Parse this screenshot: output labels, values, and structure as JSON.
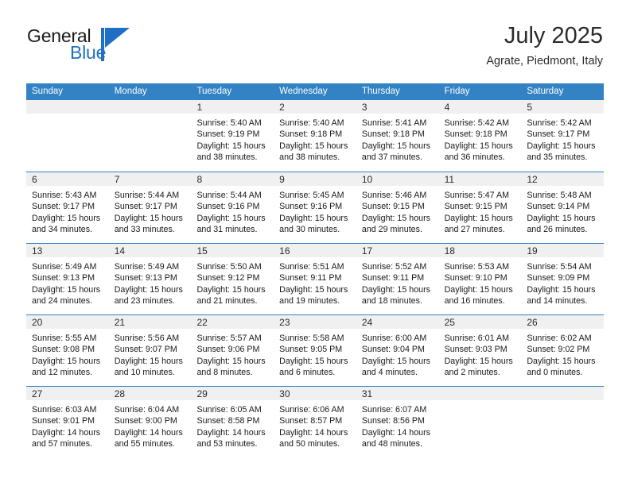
{
  "brand": {
    "name_part1": "General",
    "name_part2": "Blue",
    "logo_icon": "triangle-flag-logo",
    "accent_color": "#1F6FC4"
  },
  "header": {
    "month_title": "July 2025",
    "location": "Agrate, Piedmont, Italy"
  },
  "theme": {
    "header_blue": "#3282C4",
    "daynum_strip": "#F0F0F0",
    "text": "#1a1a1a"
  },
  "weekdays": [
    "Sunday",
    "Monday",
    "Tuesday",
    "Wednesday",
    "Thursday",
    "Friday",
    "Saturday"
  ],
  "weeks": [
    [
      {
        "day": "",
        "lines": []
      },
      {
        "day": "",
        "lines": []
      },
      {
        "day": "1",
        "lines": [
          "Sunrise: 5:40 AM",
          "Sunset: 9:19 PM",
          "Daylight: 15 hours",
          "and 38 minutes."
        ]
      },
      {
        "day": "2",
        "lines": [
          "Sunrise: 5:40 AM",
          "Sunset: 9:18 PM",
          "Daylight: 15 hours",
          "and 38 minutes."
        ]
      },
      {
        "day": "3",
        "lines": [
          "Sunrise: 5:41 AM",
          "Sunset: 9:18 PM",
          "Daylight: 15 hours",
          "and 37 minutes."
        ]
      },
      {
        "day": "4",
        "lines": [
          "Sunrise: 5:42 AM",
          "Sunset: 9:18 PM",
          "Daylight: 15 hours",
          "and 36 minutes."
        ]
      },
      {
        "day": "5",
        "lines": [
          "Sunrise: 5:42 AM",
          "Sunset: 9:17 PM",
          "Daylight: 15 hours",
          "and 35 minutes."
        ]
      }
    ],
    [
      {
        "day": "6",
        "lines": [
          "Sunrise: 5:43 AM",
          "Sunset: 9:17 PM",
          "Daylight: 15 hours",
          "and 34 minutes."
        ]
      },
      {
        "day": "7",
        "lines": [
          "Sunrise: 5:44 AM",
          "Sunset: 9:17 PM",
          "Daylight: 15 hours",
          "and 33 minutes."
        ]
      },
      {
        "day": "8",
        "lines": [
          "Sunrise: 5:44 AM",
          "Sunset: 9:16 PM",
          "Daylight: 15 hours",
          "and 31 minutes."
        ]
      },
      {
        "day": "9",
        "lines": [
          "Sunrise: 5:45 AM",
          "Sunset: 9:16 PM",
          "Daylight: 15 hours",
          "and 30 minutes."
        ]
      },
      {
        "day": "10",
        "lines": [
          "Sunrise: 5:46 AM",
          "Sunset: 9:15 PM",
          "Daylight: 15 hours",
          "and 29 minutes."
        ]
      },
      {
        "day": "11",
        "lines": [
          "Sunrise: 5:47 AM",
          "Sunset: 9:15 PM",
          "Daylight: 15 hours",
          "and 27 minutes."
        ]
      },
      {
        "day": "12",
        "lines": [
          "Sunrise: 5:48 AM",
          "Sunset: 9:14 PM",
          "Daylight: 15 hours",
          "and 26 minutes."
        ]
      }
    ],
    [
      {
        "day": "13",
        "lines": [
          "Sunrise: 5:49 AM",
          "Sunset: 9:13 PM",
          "Daylight: 15 hours",
          "and 24 minutes."
        ]
      },
      {
        "day": "14",
        "lines": [
          "Sunrise: 5:49 AM",
          "Sunset: 9:13 PM",
          "Daylight: 15 hours",
          "and 23 minutes."
        ]
      },
      {
        "day": "15",
        "lines": [
          "Sunrise: 5:50 AM",
          "Sunset: 9:12 PM",
          "Daylight: 15 hours",
          "and 21 minutes."
        ]
      },
      {
        "day": "16",
        "lines": [
          "Sunrise: 5:51 AM",
          "Sunset: 9:11 PM",
          "Daylight: 15 hours",
          "and 19 minutes."
        ]
      },
      {
        "day": "17",
        "lines": [
          "Sunrise: 5:52 AM",
          "Sunset: 9:11 PM",
          "Daylight: 15 hours",
          "and 18 minutes."
        ]
      },
      {
        "day": "18",
        "lines": [
          "Sunrise: 5:53 AM",
          "Sunset: 9:10 PM",
          "Daylight: 15 hours",
          "and 16 minutes."
        ]
      },
      {
        "day": "19",
        "lines": [
          "Sunrise: 5:54 AM",
          "Sunset: 9:09 PM",
          "Daylight: 15 hours",
          "and 14 minutes."
        ]
      }
    ],
    [
      {
        "day": "20",
        "lines": [
          "Sunrise: 5:55 AM",
          "Sunset: 9:08 PM",
          "Daylight: 15 hours",
          "and 12 minutes."
        ]
      },
      {
        "day": "21",
        "lines": [
          "Sunrise: 5:56 AM",
          "Sunset: 9:07 PM",
          "Daylight: 15 hours",
          "and 10 minutes."
        ]
      },
      {
        "day": "22",
        "lines": [
          "Sunrise: 5:57 AM",
          "Sunset: 9:06 PM",
          "Daylight: 15 hours",
          "and 8 minutes."
        ]
      },
      {
        "day": "23",
        "lines": [
          "Sunrise: 5:58 AM",
          "Sunset: 9:05 PM",
          "Daylight: 15 hours",
          "and 6 minutes."
        ]
      },
      {
        "day": "24",
        "lines": [
          "Sunrise: 6:00 AM",
          "Sunset: 9:04 PM",
          "Daylight: 15 hours",
          "and 4 minutes."
        ]
      },
      {
        "day": "25",
        "lines": [
          "Sunrise: 6:01 AM",
          "Sunset: 9:03 PM",
          "Daylight: 15 hours",
          "and 2 minutes."
        ]
      },
      {
        "day": "26",
        "lines": [
          "Sunrise: 6:02 AM",
          "Sunset: 9:02 PM",
          "Daylight: 15 hours",
          "and 0 minutes."
        ]
      }
    ],
    [
      {
        "day": "27",
        "lines": [
          "Sunrise: 6:03 AM",
          "Sunset: 9:01 PM",
          "Daylight: 14 hours",
          "and 57 minutes."
        ]
      },
      {
        "day": "28",
        "lines": [
          "Sunrise: 6:04 AM",
          "Sunset: 9:00 PM",
          "Daylight: 14 hours",
          "and 55 minutes."
        ]
      },
      {
        "day": "29",
        "lines": [
          "Sunrise: 6:05 AM",
          "Sunset: 8:58 PM",
          "Daylight: 14 hours",
          "and 53 minutes."
        ]
      },
      {
        "day": "30",
        "lines": [
          "Sunrise: 6:06 AM",
          "Sunset: 8:57 PM",
          "Daylight: 14 hours",
          "and 50 minutes."
        ]
      },
      {
        "day": "31",
        "lines": [
          "Sunrise: 6:07 AM",
          "Sunset: 8:56 PM",
          "Daylight: 14 hours",
          "and 48 minutes."
        ]
      },
      {
        "day": "",
        "lines": []
      },
      {
        "day": "",
        "lines": []
      }
    ]
  ]
}
